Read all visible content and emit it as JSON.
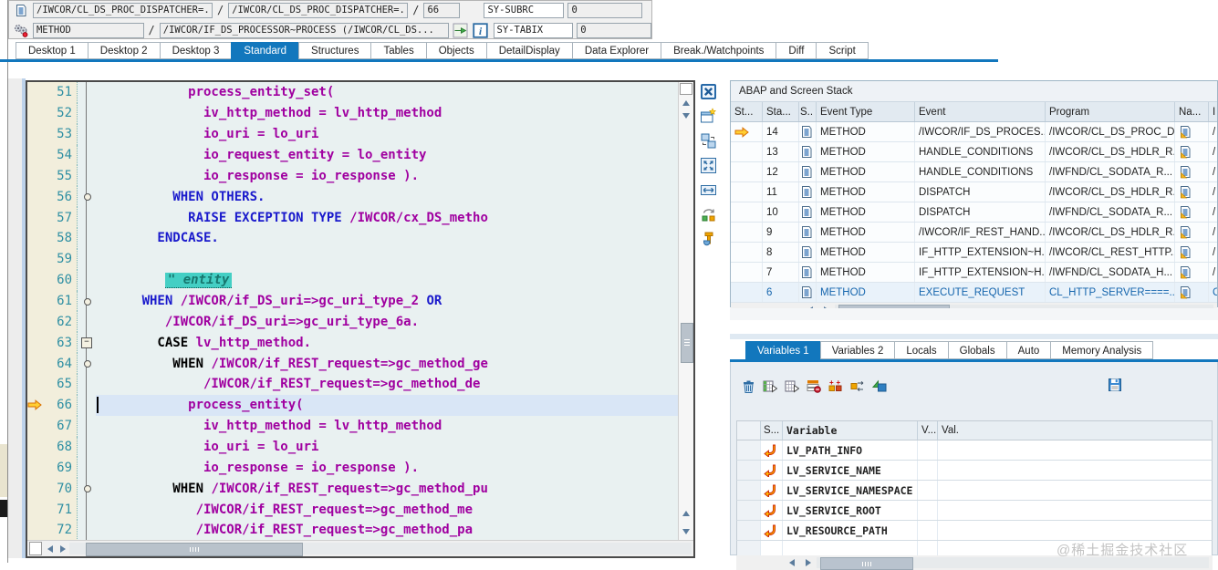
{
  "topbar": {
    "row1": {
      "field_a": "/IWCOR/CL_DS_PROC_DISPATCHER=...",
      "sep_a": "/",
      "field_b": "/IWCOR/CL_DS_PROC_DISPATCHER=...",
      "sep_b": "/",
      "field_c": "66",
      "sys_name": "SY-SUBRC",
      "sys_value": "0"
    },
    "row2": {
      "field_a": "METHOD",
      "sep_a": "/",
      "field_b": "/IWCOR/IF_DS_PROCESSOR~PROCESS (/IWCOR/CL_DS...",
      "sys_name": "SY-TABIX",
      "sys_value": "0"
    }
  },
  "tabs": {
    "active": "Standard",
    "items": [
      "Desktop 1",
      "Desktop 2",
      "Desktop 3",
      "Standard",
      "Structures",
      "Tables",
      "Objects",
      "DetailDisplay",
      "Data Explorer",
      "Break./Watchpoints",
      "Diff",
      "Script"
    ]
  },
  "editor": {
    "current_line": 66,
    "lines": [
      {
        "n": 51,
        "i": 12,
        "parts": [
          [
            "id",
            "process_entity_set("
          ]
        ]
      },
      {
        "n": 52,
        "i": 14,
        "parts": [
          [
            "id",
            "iv_http_method = lv_http_method"
          ]
        ]
      },
      {
        "n": 53,
        "i": 14,
        "parts": [
          [
            "id",
            "io_uri = lo_uri"
          ]
        ]
      },
      {
        "n": 54,
        "i": 14,
        "parts": [
          [
            "id",
            "io_request_entity = lo_entity"
          ]
        ]
      },
      {
        "n": 55,
        "i": 14,
        "parts": [
          [
            "id",
            "io_response = io_response )."
          ]
        ]
      },
      {
        "n": 56,
        "i": 10,
        "m": "dot",
        "parts": [
          [
            "kw",
            "WHEN OTHERS."
          ]
        ]
      },
      {
        "n": 57,
        "i": 12,
        "parts": [
          [
            "kw",
            "RAISE EXCEPTION TYPE "
          ],
          [
            "id",
            "/IWCOR/cx_DS_metho"
          ]
        ]
      },
      {
        "n": 58,
        "i": 8,
        "parts": [
          [
            "kw",
            "ENDCASE."
          ]
        ]
      },
      {
        "n": 59,
        "i": 0,
        "parts": []
      },
      {
        "n": 60,
        "i": 9,
        "parts": [
          [
            "cm",
            "\" entity"
          ]
        ]
      },
      {
        "n": 61,
        "i": 6,
        "m": "dot",
        "parts": [
          [
            "kw",
            "WHEN "
          ],
          [
            "id",
            "/IWCOR/if_DS_uri=>gc_uri_type_2 "
          ],
          [
            "kw",
            "OR"
          ]
        ]
      },
      {
        "n": 62,
        "i": 9,
        "parts": [
          [
            "id",
            "/IWCOR/if_DS_uri=>gc_uri_type_6a."
          ]
        ]
      },
      {
        "n": 63,
        "i": 8,
        "m": "minus",
        "parts": [
          [
            "kb",
            "CASE "
          ],
          [
            "id",
            "lv_http_method."
          ]
        ]
      },
      {
        "n": 64,
        "i": 10,
        "m": "dot",
        "parts": [
          [
            "kb",
            "WHEN "
          ],
          [
            "id",
            "/IWCOR/if_REST_request=>gc_method_ge"
          ]
        ]
      },
      {
        "n": 65,
        "i": 14,
        "parts": [
          [
            "id",
            "/IWCOR/if_REST_request=>gc_method_de"
          ]
        ]
      },
      {
        "n": 66,
        "i": 12,
        "parts": [
          [
            "id",
            "process_entity("
          ]
        ]
      },
      {
        "n": 67,
        "i": 14,
        "parts": [
          [
            "id",
            "iv_http_method = lv_http_method"
          ]
        ]
      },
      {
        "n": 68,
        "i": 14,
        "parts": [
          [
            "id",
            "io_uri = lo_uri"
          ]
        ]
      },
      {
        "n": 69,
        "i": 14,
        "parts": [
          [
            "id",
            "io_response = io_response )."
          ]
        ]
      },
      {
        "n": 70,
        "i": 10,
        "m": "dot",
        "parts": [
          [
            "kb",
            "WHEN "
          ],
          [
            "id",
            "/IWCOR/if_REST_request=>gc_method_pu"
          ]
        ]
      },
      {
        "n": 71,
        "i": 13,
        "parts": [
          [
            "id",
            "/IWCOR/if_REST_request=>gc_method_me"
          ]
        ]
      },
      {
        "n": 72,
        "i": 13,
        "parts": [
          [
            "id",
            "/IWCOR/if_REST_request=>gc_method_pa"
          ]
        ]
      }
    ]
  },
  "side_toolbar": {
    "icons": [
      "close",
      "new-window",
      "swap-views",
      "maximize",
      "fit-width",
      "sync",
      "tools"
    ]
  },
  "stack_panel": {
    "title": "ABAP and Screen Stack",
    "columns": [
      "St...",
      "Sta...",
      "S..",
      "Event Type",
      "Event",
      "Program",
      "Na...",
      "I"
    ],
    "rows": [
      {
        "current": true,
        "stack_no": "14",
        "event_type": "METHOD",
        "event": "/IWCOR/IF_DS_PROCES...",
        "program": "/IWCOR/CL_DS_PROC_D...",
        "extra": "/"
      },
      {
        "stack_no": "13",
        "event_type": "METHOD",
        "event": "HANDLE_CONDITIONS",
        "program": "/IWCOR/CL_DS_HDLR_R...",
        "extra": "/"
      },
      {
        "stack_no": "12",
        "event_type": "METHOD",
        "event": "HANDLE_CONDITIONS",
        "program": "/IWFND/CL_SODATA_R...",
        "extra": "/"
      },
      {
        "stack_no": "11",
        "event_type": "METHOD",
        "event": "DISPATCH",
        "program": "/IWCOR/CL_DS_HDLR_R...",
        "extra": "/"
      },
      {
        "stack_no": "10",
        "event_type": "METHOD",
        "event": "DISPATCH",
        "program": "/IWFND/CL_SODATA_R...",
        "extra": "/"
      },
      {
        "stack_no": "9",
        "event_type": "METHOD",
        "event": "/IWCOR/IF_REST_HAND...",
        "program": "/IWCOR/CL_DS_HDLR_R...",
        "extra": "/"
      },
      {
        "stack_no": "8",
        "event_type": "METHOD",
        "event": "IF_HTTP_EXTENSION~H...",
        "program": "/IWCOR/CL_REST_HTTP...",
        "extra": "/"
      },
      {
        "stack_no": "7",
        "event_type": "METHOD",
        "event": "IF_HTTP_EXTENSION~H...",
        "program": "/IWFND/CL_SODATA_H...",
        "extra": "/"
      },
      {
        "stack_no": "6",
        "selected": true,
        "event_type": "METHOD",
        "event": "EXECUTE_REQUEST",
        "program": "CL_HTTP_SERVER====...",
        "extra": "C"
      }
    ]
  },
  "variables_panel": {
    "active": "Variables 1",
    "tabs": [
      "Variables 1",
      "Variables 2",
      "Locals",
      "Globals",
      "Auto",
      "Memory Analysis"
    ],
    "toolbar_icons": [
      "delete",
      "insert-row",
      "display-row",
      "remove-row",
      "add-variables",
      "swap-variable",
      "compare"
    ],
    "save_icon": "save",
    "columns": [
      "",
      "S...",
      "Variable",
      "V...",
      "Val."
    ],
    "rows": [
      {
        "name": "LV_PATH_INFO",
        "vtype": "",
        "value": ""
      },
      {
        "name": "LV_SERVICE_NAME",
        "vtype": "",
        "value": ""
      },
      {
        "name": "LV_SERVICE_NAMESPACE",
        "vtype": "",
        "value": ""
      },
      {
        "name": "LV_SERVICE_ROOT",
        "vtype": "",
        "value": ""
      },
      {
        "name": "LV_RESOURCE_PATH",
        "vtype": "",
        "value": ""
      },
      {
        "name": "",
        "vtype": "",
        "value": "",
        "empty": true
      }
    ]
  },
  "colors": {
    "accent_blue": "#1277bd",
    "keyword_blue": "#1a1acc",
    "identifier_purple": "#a000a0",
    "comment_highlight": "#44cfc4",
    "current_line_bg": "#d9e6f6",
    "margin_cream": "#f2eedc"
  },
  "watermark": "@稀土掘金技术社区"
}
